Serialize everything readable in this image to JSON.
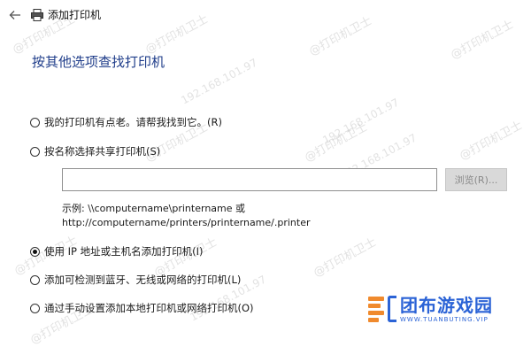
{
  "window": {
    "title": "添加打印机"
  },
  "heading": "按其他选项查找打印机",
  "options": [
    {
      "label": "我的打印机有点老。请帮我找到它。(R)",
      "checked": false
    },
    {
      "label": "按名称选择共享打印机(S)",
      "checked": false
    },
    {
      "label": "使用 IP 地址或主机名添加打印机(I)",
      "checked": true
    },
    {
      "label": "添加可检测到蓝牙、无线或网络的打印机(L)",
      "checked": false
    },
    {
      "label": "通过手动设置添加本地打印机或网络打印机(O)",
      "checked": false
    }
  ],
  "shared_name": {
    "value": "",
    "browse_label": "浏览(R)..."
  },
  "example": {
    "line1": "示例: \\\\computername\\printername 或",
    "line2": "http://computername/printers/printername/.printer"
  },
  "watermarks": [
    "@打印机卫士",
    "192.168.101.97"
  ],
  "brand": {
    "name": "团布游戏园",
    "url": "WWW.TUANBUTING.VIP"
  },
  "colors": {
    "heading": "#1f3d8a",
    "brand_blue": "#2b63d6",
    "brand_orange": "#f08a2d"
  }
}
